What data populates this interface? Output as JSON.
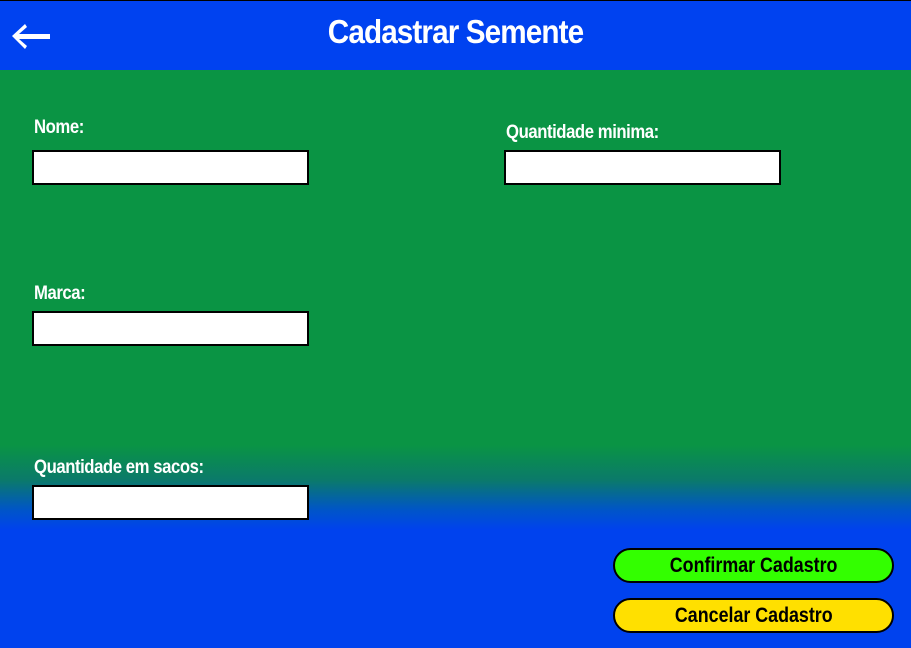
{
  "header": {
    "title": "Cadastrar Semente",
    "back_icon": "arrow-left-icon"
  },
  "form": {
    "nome": {
      "label": "Nome:",
      "value": ""
    },
    "marca": {
      "label": "Marca:",
      "value": ""
    },
    "quantidade_sacos": {
      "label": "Quantidade em sacos:",
      "value": ""
    },
    "quantidade_minima": {
      "label": "Quantidade minima:",
      "value": ""
    }
  },
  "buttons": {
    "confirm": {
      "label": "Confirmar Cadastro",
      "color": "#33ff00"
    },
    "cancel": {
      "label": "Cancelar Cadastro",
      "color": "#ffe000"
    }
  },
  "colors": {
    "header": "#0042f0",
    "body_green": "#0a9444",
    "body_blue": "#0042ee"
  }
}
